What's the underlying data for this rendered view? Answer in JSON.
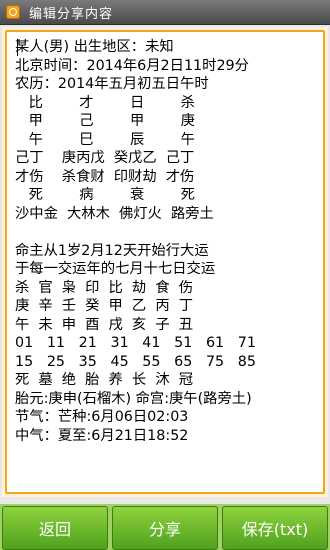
{
  "window": {
    "title": "编辑分享内容",
    "app_icon": "gear-icon"
  },
  "accent_color": "#f5a422",
  "content_lines": [
    "某人(男) 出生地区：未知",
    "北京时间：2014年6月2日11时29分",
    "农历：2014年五月初五日午时",
    "   比        才        日        杀",
    "   甲        己        甲        庚",
    "   午        巳        辰        午",
    "己丁    庚丙戊  癸戊乙  己丁",
    "才伤    杀食财  印财劫  才伤",
    "   死        病        衰        死",
    "沙中金  大林木  佛灯火  路旁土",
    "",
    "命主从1岁2月12天开始行大运",
    "于每一交运年的七月十七日交运",
    "杀  官  枭  印  比  劫  食  伤",
    "庚  辛  壬  癸  甲  乙  丙  丁",
    "午  未  申  酉  戌  亥  子  丑",
    "01   11   21   31   41   51   61   71",
    "15   25   35   45   55   65   75   85",
    "死  墓  绝  胎  养  长  沐  冠",
    "胎元:庚申(石榴木) 命宫:庚午(路旁土)",
    "节气：芒种:6月06日02:03",
    "中气：夏至:6月21日18:52"
  ],
  "buttons": {
    "back": "返回",
    "share": "分享",
    "save": "保存(txt)"
  }
}
